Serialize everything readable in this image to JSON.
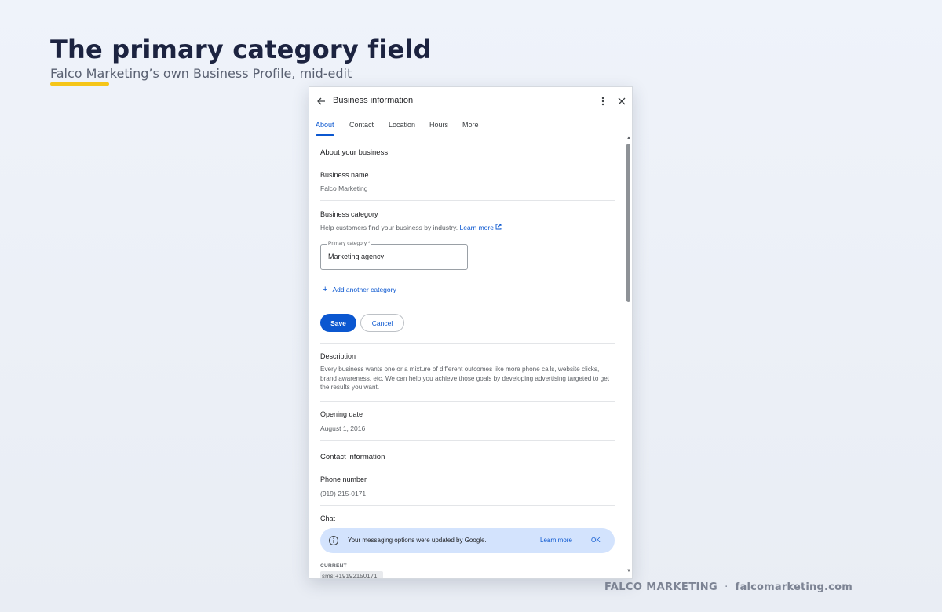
{
  "slide": {
    "title": "The primary category field",
    "subtitle": "Falco Marketing’s own Business Profile, mid-edit",
    "footer_brand": "FALCO MARKETING",
    "footer_sep": "·",
    "footer_site": "falcomarketing.com",
    "accent_color": "#f5c518"
  },
  "panel": {
    "title": "Business information",
    "tabs": [
      {
        "label": "About",
        "active": true
      },
      {
        "label": "Contact",
        "active": false
      },
      {
        "label": "Location",
        "active": false
      },
      {
        "label": "Hours",
        "active": false
      },
      {
        "label": "More",
        "active": false
      }
    ],
    "about": {
      "heading": "About your business",
      "business_name_label": "Business name",
      "business_name_value": "Falco Marketing",
      "category_label": "Business category",
      "category_help": "Help customers find your business by industry.",
      "category_learn_more": "Learn more",
      "primary_category_label": "Primary category *",
      "primary_category_value": "Marketing agency",
      "add_category": "Add another category",
      "save": "Save",
      "cancel": "Cancel",
      "description_label": "Description",
      "description_value": "Every business wants one or a mixture of different outcomes like more phone calls, website clicks, brand awareness, etc. We can help you achieve those goals by developing advertising targeted to get the results you want.",
      "opening_date_label": "Opening date",
      "opening_date_value": "August 1, 2016"
    },
    "contact": {
      "heading": "Contact information",
      "phone_label": "Phone number",
      "phone_value": "(919) 215-0171",
      "chat_label": "Chat",
      "banner_text": "Your messaging options were updated by Google.",
      "banner_learn_more": "Learn more",
      "banner_ok": "OK",
      "current_label": "CURRENT",
      "current_value": "sms:+19192150171"
    },
    "colors": {
      "primary_blue": "#0b57d0",
      "banner_bg": "#d3e3fd"
    }
  }
}
